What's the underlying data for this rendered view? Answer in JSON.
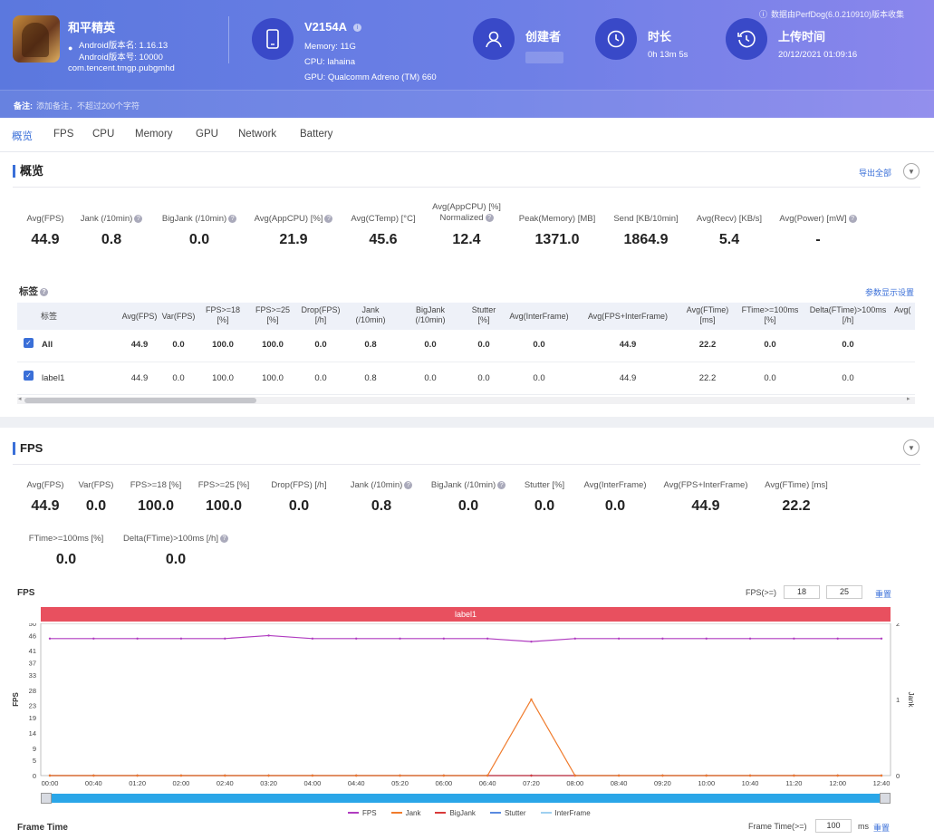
{
  "header": {
    "game": {
      "name": "和平精英",
      "android_version": "Android版本名: 1.16.13",
      "android_code": "Android版本号: 10000",
      "package": "com.tencent.tmgp.pubgmhd"
    },
    "device": {
      "name": "V2154A",
      "memory": "Memory: 11G",
      "cpu": "CPU: lahaina",
      "gpu": "GPU: Qualcomm Adreno (TM) 660"
    },
    "creator_label": "创建者",
    "duration": {
      "label": "时长",
      "value": "0h 13m 5s"
    },
    "upload": {
      "label": "上传时间",
      "value": "20/12/2021 01:09:16"
    },
    "source": "数据由PerfDog(6.0.210910)版本收集",
    "note_label": "备注:",
    "note_placeholder": "添加备注，不超过200个字符"
  },
  "tabs": [
    "概览",
    "FPS",
    "CPU",
    "Memory",
    "GPU",
    "Network",
    "Battery"
  ],
  "overview": {
    "title": "概览",
    "export": "导出全部",
    "metrics": [
      {
        "label": "Avg(FPS)",
        "value": "44.9"
      },
      {
        "label": "Jank (/10min)",
        "value": "0.8"
      },
      {
        "label": "BigJank (/10min)",
        "value": "0.0"
      },
      {
        "label": "Avg(AppCPU) [%]",
        "value": "21.9"
      },
      {
        "label": "Avg(CTemp) [°C]",
        "value": "45.6"
      },
      {
        "label": "Avg(AppCPU) [%] Normalized",
        "value": "12.4"
      },
      {
        "label": "Peak(Memory) [MB]",
        "value": "1371.0"
      },
      {
        "label": "Send [KB/10min]",
        "value": "1864.9"
      },
      {
        "label": "Avg(Recv) [KB/s]",
        "value": "5.4"
      },
      {
        "label": "Avg(Power) [mW]",
        "value": "-"
      }
    ],
    "labels_title": "标签",
    "display_settings": "参数显示设置",
    "table": {
      "headers": [
        "标签",
        "Avg(FPS)",
        "Var(FPS)",
        "FPS>=18 [%]",
        "FPS>=25 [%]",
        "Drop(FPS) [/h]",
        "Jank (/10min)",
        "BigJank (/10min)",
        "Stutter [%]",
        "Avg(InterFrame)",
        "Avg(FPS+InterFrame)",
        "Avg(FTime) [ms]",
        "FTime>=100ms [%]",
        "Delta(FTime)>100ms [/h]",
        "Avg("
      ],
      "rows": [
        [
          "All",
          "44.9",
          "0.0",
          "100.0",
          "100.0",
          "0.0",
          "0.8",
          "0.0",
          "0.0",
          "0.0",
          "44.9",
          "22.2",
          "0.0",
          "0.0"
        ],
        [
          "label1",
          "44.9",
          "0.0",
          "100.0",
          "100.0",
          "0.0",
          "0.8",
          "0.0",
          "0.0",
          "0.0",
          "44.9",
          "22.2",
          "0.0",
          "0.0"
        ]
      ]
    }
  },
  "fps_section": {
    "title": "FPS",
    "metrics": [
      {
        "label": "Avg(FPS)",
        "value": "44.9"
      },
      {
        "label": "Var(FPS)",
        "value": "0.0"
      },
      {
        "label": "FPS>=18 [%]",
        "value": "100.0"
      },
      {
        "label": "FPS>=25 [%]",
        "value": "100.0"
      },
      {
        "label": "Drop(FPS) [/h]",
        "value": "0.0"
      },
      {
        "label": "Jank (/10min)",
        "value": "0.8"
      },
      {
        "label": "BigJank (/10min)",
        "value": "0.0"
      },
      {
        "label": "Stutter [%]",
        "value": "0.0"
      },
      {
        "label": "Avg(InterFrame)",
        "value": "0.0"
      },
      {
        "label": "Avg(FPS+InterFrame)",
        "value": "44.9"
      },
      {
        "label": "Avg(FTime) [ms]",
        "value": "22.2"
      },
      {
        "label": "FTime>=100ms [%]",
        "value": "0.0"
      },
      {
        "label": "Delta(FTime)>100ms [/h]",
        "value": "0.0"
      }
    ],
    "chart_title": "FPS",
    "threshold_label": "FPS(>=)",
    "threshold_1": "18",
    "threshold_2": "25",
    "reset": "重置",
    "label_bar": "label1",
    "frame_time_title": "Frame Time",
    "frame_time_label": "Frame Time(>=)",
    "frame_time_value": "100",
    "frame_time_unit": "ms",
    "frame_time_reset": "重置"
  },
  "chart_data": {
    "type": "line",
    "title": "FPS",
    "ylabel": "FPS",
    "y2label": "Jank",
    "ylim": [
      0,
      50
    ],
    "y2lim": [
      0,
      2
    ],
    "yticks": [
      "50",
      "46",
      "41",
      "37",
      "33",
      "28",
      "23",
      "19",
      "14",
      "9",
      "5",
      "0"
    ],
    "y2ticks": [
      "2",
      "1",
      "0"
    ],
    "xticks": [
      "00:00",
      "00:40",
      "01:20",
      "02:00",
      "02:40",
      "03:20",
      "04:00",
      "04:40",
      "05:20",
      "06:00",
      "06:40",
      "07:20",
      "08:00",
      "08:40",
      "09:20",
      "10:00",
      "10:40",
      "11:20",
      "12:00",
      "12:40"
    ],
    "series": [
      {
        "name": "FPS",
        "color": "#b03cc0",
        "values": [
          45,
          45,
          45,
          45,
          45,
          46,
          45,
          45,
          45,
          45,
          45,
          44,
          45,
          45,
          45,
          45,
          45,
          45,
          45,
          45
        ]
      },
      {
        "name": "Jank",
        "color": "#f07b2c",
        "values": [
          0,
          0,
          0,
          0,
          0,
          0,
          0,
          0,
          0,
          0,
          0,
          1,
          0,
          0,
          0,
          0,
          0,
          0,
          0,
          0
        ]
      },
      {
        "name": "BigJank",
        "color": "#d93a3a",
        "values": [
          0,
          0,
          0,
          0,
          0,
          0,
          0,
          0,
          0,
          0,
          0,
          0,
          0,
          0,
          0,
          0,
          0,
          0,
          0,
          0
        ]
      },
      {
        "name": "Stutter",
        "color": "#5a8ae0",
        "values": [
          0,
          0,
          0,
          0,
          0,
          0,
          0,
          0,
          0,
          0,
          0,
          0,
          0,
          0,
          0,
          0,
          0,
          0,
          0,
          0
        ]
      },
      {
        "name": "InterFrame",
        "color": "#9fd0f0",
        "values": [
          0,
          0,
          0,
          0,
          0,
          0,
          0,
          0,
          0,
          0,
          0,
          0,
          0,
          0,
          0,
          0,
          0,
          0,
          0,
          0
        ]
      }
    ],
    "legend": "bottom"
  }
}
